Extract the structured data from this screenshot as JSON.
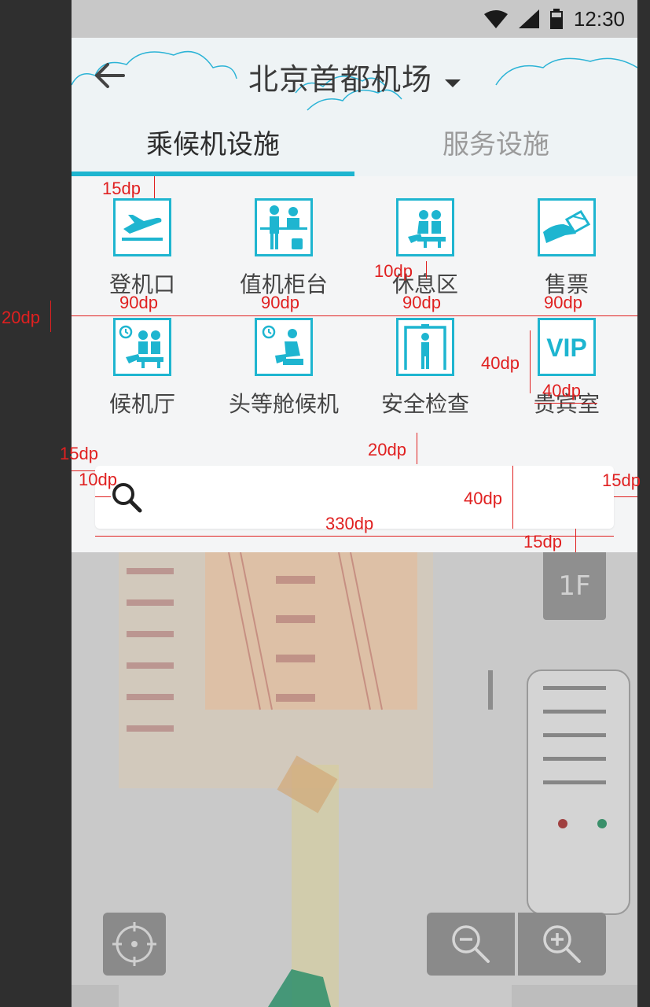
{
  "status": {
    "time": "12:30"
  },
  "header": {
    "title": "北京首都机场"
  },
  "tabs": [
    {
      "label": "乘候机设施",
      "active": true
    },
    {
      "label": "服务设施",
      "active": false
    }
  ],
  "facilities": [
    {
      "label": "登机口",
      "icon": "departure-icon"
    },
    {
      "label": "值机柜台",
      "icon": "checkin-counter-icon"
    },
    {
      "label": "休息区",
      "icon": "rest-area-icon"
    },
    {
      "label": "售票",
      "icon": "ticket-icon"
    },
    {
      "label": "候机厅",
      "icon": "waiting-hall-icon"
    },
    {
      "label": "头等舱候机",
      "icon": "first-class-lounge-icon"
    },
    {
      "label": "安全检查",
      "icon": "security-check-icon"
    },
    {
      "label": "贵宾室",
      "icon": "vip-icon",
      "icon_text": "VIP"
    }
  ],
  "search": {
    "placeholder": ""
  },
  "map": {
    "floor": "1F"
  },
  "annotations": {
    "a15dp_top": "15dp",
    "a10dp_gap": "10dp",
    "a20dp_row": "20dp",
    "col1": "90dp",
    "col2": "90dp",
    "col3": "90dp",
    "col4": "90dp",
    "icon_h": "40dp",
    "icon_w": "40dp",
    "a20dp_search": "20dp",
    "a15dp_left": "15dp",
    "a10dp_search": "10dp",
    "a15dp_right": "15dp",
    "search_h": "40dp",
    "search_w": "330dp",
    "a15dp_bottom": "15dp"
  },
  "colors": {
    "accent": "#1eb5d0",
    "annotation": "#e02020"
  }
}
